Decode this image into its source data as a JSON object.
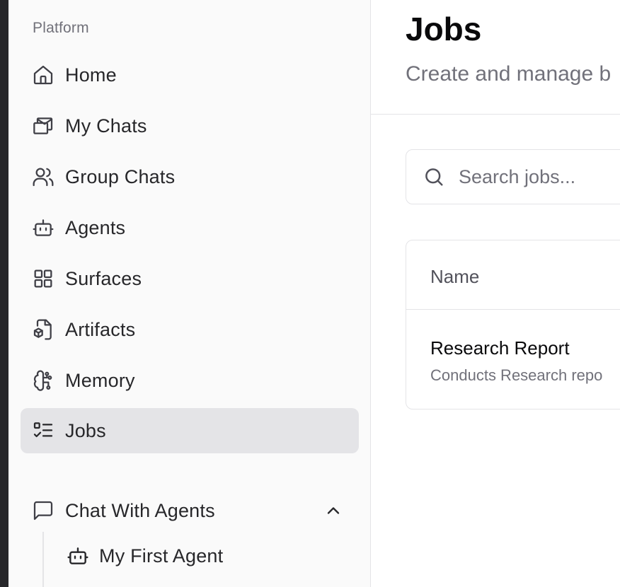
{
  "sidebar": {
    "section_label": "Platform",
    "items": [
      {
        "label": "Home",
        "icon": "home-icon"
      },
      {
        "label": "My Chats",
        "icon": "mail-chats-icon"
      },
      {
        "label": "Group Chats",
        "icon": "users-icon"
      },
      {
        "label": "Agents",
        "icon": "bot-icon"
      },
      {
        "label": "Surfaces",
        "icon": "grid-icon"
      },
      {
        "label": "Artifacts",
        "icon": "file-box-icon"
      },
      {
        "label": "Memory",
        "icon": "brain-icon"
      },
      {
        "label": "Jobs",
        "icon": "list-checks-icon",
        "active": true
      }
    ],
    "group": {
      "label": "Chat With Agents",
      "icon": "message-square-icon",
      "expanded": true,
      "children": [
        {
          "label": "My First Agent",
          "icon": "bot-icon"
        }
      ]
    }
  },
  "main": {
    "title": "Jobs",
    "subtitle": "Create and manage b",
    "search": {
      "placeholder": "Search jobs...",
      "value": ""
    },
    "table": {
      "columns": [
        "Name"
      ],
      "rows": [
        {
          "name": "Research Report",
          "description": "Conducts Research repo"
        }
      ]
    }
  },
  "colors": {
    "sidebar_bg": "#fafafa",
    "active_item_bg": "#e4e4e7",
    "border": "#e4e4e7",
    "muted_text": "#71717a",
    "primary_text": "#09090b"
  }
}
